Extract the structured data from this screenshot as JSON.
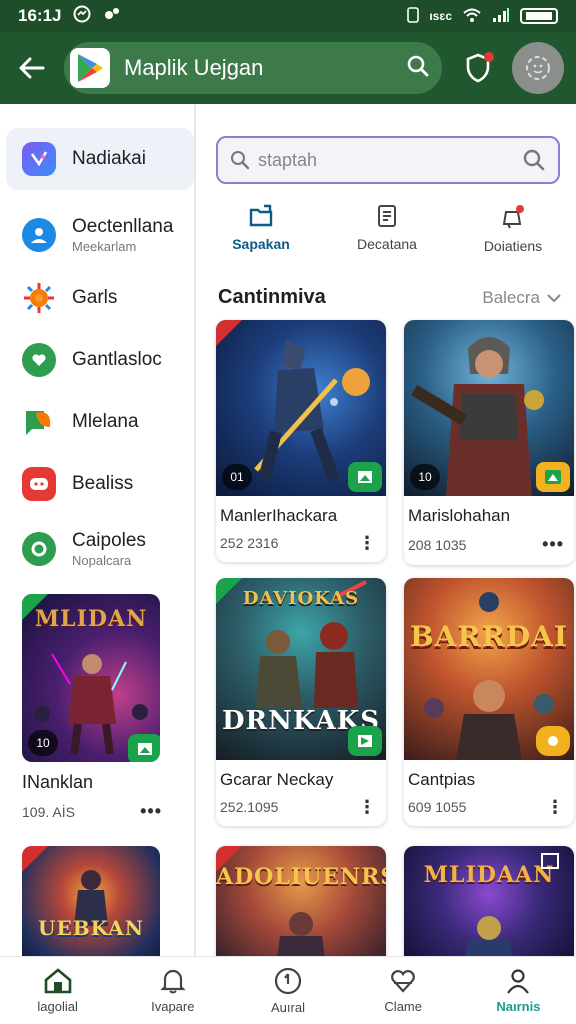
{
  "status_bar": {
    "time": "16:1J",
    "right_text": "ısɛc"
  },
  "app_bar": {
    "title": "Maplik Uejgan"
  },
  "sidebar": {
    "items": [
      {
        "label": "Nadiakai",
        "sub": "",
        "icon": "app-icon",
        "color": "#5b6cf0"
      },
      {
        "label": "Oectenllana",
        "sub": "Meekarlam",
        "icon": "person-icon",
        "color": "#1e88e5"
      },
      {
        "label": "Garls",
        "sub": "",
        "icon": "burst-icon",
        "color": "#f57c00"
      },
      {
        "label": "Gantlasloc",
        "sub": "",
        "icon": "chat-heart-icon",
        "color": "#2e7d32"
      },
      {
        "label": "Mlelana",
        "sub": "",
        "icon": "leaf-chat-icon",
        "color": "#2e9d4e"
      },
      {
        "label": "Bealiss",
        "sub": "",
        "icon": "message-icon",
        "color": "#e53935"
      },
      {
        "label": "Caipoles",
        "sub": "Nopalcara",
        "icon": "chat-circle-icon",
        "color": "#2e9d4e"
      }
    ],
    "cards": [
      {
        "art_title": "MLIDAN",
        "name": "INanklan",
        "meta": "109. AİS",
        "badge_left": "10"
      },
      {
        "art_title": "UEBKAN",
        "name": "",
        "meta": "",
        "badge_left": ""
      }
    ]
  },
  "search": {
    "placeholder": "staptah"
  },
  "categories": [
    {
      "label": "Sapakan",
      "icon": "folder-icon",
      "active": true
    },
    {
      "label": "Decatana",
      "icon": "document-icon",
      "active": false
    },
    {
      "label": "Doiatiens",
      "icon": "notification-icon",
      "active": false
    }
  ],
  "section": {
    "title": "Cantinmiva",
    "sort_label": "Balecra"
  },
  "games": [
    {
      "name": "ManlerIhackara",
      "meta": "252 2316",
      "badge_left": "01",
      "art_title": ""
    },
    {
      "name": "Marislohahan",
      "meta": "208 1035",
      "badge_left": "10",
      "art_title": ""
    },
    {
      "name": "Gcarar Neckay",
      "meta": "252.1095",
      "badge_left": "",
      "art_title": "DRNKAKS"
    },
    {
      "name": "Cantpias",
      "meta": "609 1055",
      "badge_left": "",
      "art_title": "BARRDAI"
    },
    {
      "name": "",
      "meta": "",
      "badge_left": "",
      "art_title": "ADOLIUENRS"
    },
    {
      "name": "",
      "meta": "",
      "badge_left": "",
      "art_title": "MLIDAAN"
    }
  ],
  "bottom_nav": [
    {
      "label": "lagolial",
      "icon": "home-icon",
      "active": false
    },
    {
      "label": "Ivapare",
      "icon": "bell-icon",
      "active": false
    },
    {
      "label": "Auıral",
      "icon": "compass-icon",
      "active": false
    },
    {
      "label": "Clame",
      "icon": "heart-icon",
      "active": false
    },
    {
      "label": "Naırnis",
      "icon": "person-icon",
      "active": true
    }
  ]
}
